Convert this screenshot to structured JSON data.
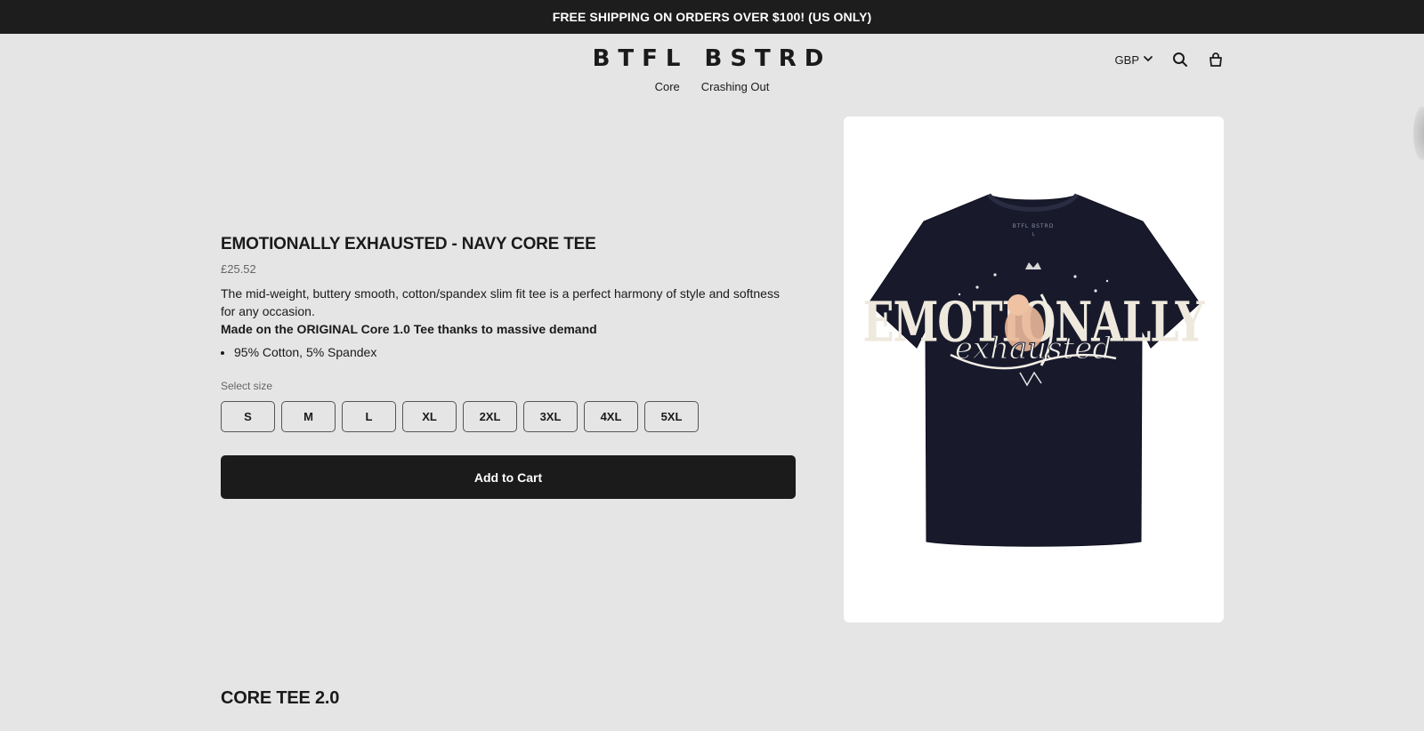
{
  "announcement": "FREE SHIPPING ON ORDERS OVER $100! (US ONLY)",
  "header": {
    "logo": "BTFL BSTRD",
    "nav": [
      "Core",
      "Crashing Out"
    ],
    "currency": "GBP",
    "icons": {
      "search": "search-icon",
      "cart": "cart-icon",
      "chevron": "chevron-down-icon"
    }
  },
  "product": {
    "title": "EMOTIONALLY EXHAUSTED - NAVY CORE TEE",
    "price": "£25.52",
    "description": "The mid-weight, buttery smooth, cotton/spandex slim fit tee is a perfect harmony of style and softness for any occasion.",
    "highlight": "Made on the ORIGINAL Core 1.0 Tee thanks to massive demand",
    "bullets": [
      "95% Cotton, 5% Spandex"
    ],
    "size_label": "Select size",
    "sizes": [
      "S",
      "M",
      "L",
      "XL",
      "2XL",
      "3XL",
      "4XL",
      "5XL"
    ],
    "add_to_cart": "Add to Cart",
    "image": {
      "shirt_color": "#181a2c",
      "tag_text": "BTFL BSTRD",
      "tag_size": "L",
      "graphic_top": "EMOTIONALLY",
      "graphic_script": "exhausted"
    }
  },
  "section_title": "CORE TEE 2.0",
  "colors": {
    "announce_bg": "#1d1d1d",
    "page_bg": "#e5e5e5",
    "button_bg": "#1b1b1b"
  }
}
